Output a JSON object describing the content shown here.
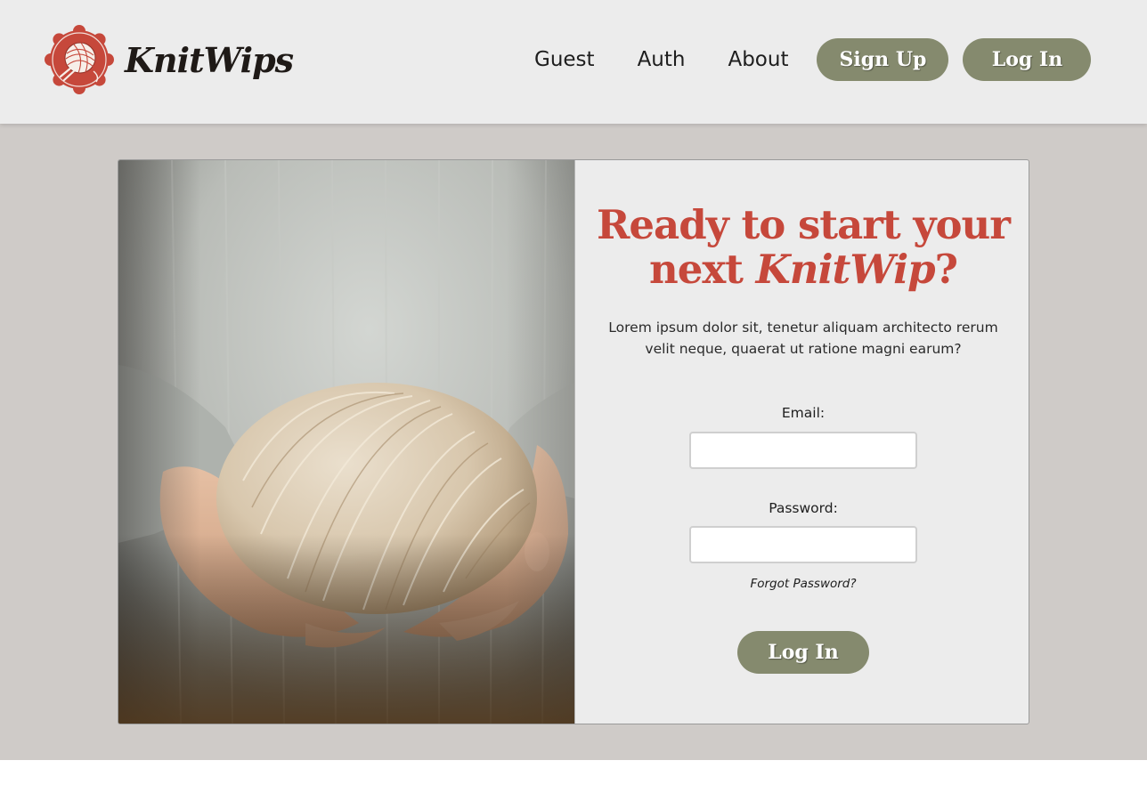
{
  "header": {
    "brand_name": "KnitWips",
    "nav": {
      "guest": "Guest",
      "auth": "Auth",
      "about": "About"
    },
    "signup_label": "Sign Up",
    "login_label": "Log In"
  },
  "hero": {
    "heading_part1": "Ready to start your",
    "heading_part2": "next ",
    "heading_accent": "KnitWip",
    "heading_end": "?",
    "lede": "Lorem ipsum dolor sit, tenetur aliquam architecto rerum velit neque, quaerat ut ratione magni earum?"
  },
  "form": {
    "email_label": "Email:",
    "email_value": "",
    "password_label": "Password:",
    "password_value": "",
    "forgot_label": "Forgot Password?",
    "submit_label": "Log In"
  },
  "colors": {
    "accent_red": "#c6483b",
    "button_olive": "#858a6e",
    "header_bg": "#ececec",
    "page_bg": "#cfcbc8"
  },
  "icons": {
    "logo": "yarn-ball-badge-icon"
  }
}
